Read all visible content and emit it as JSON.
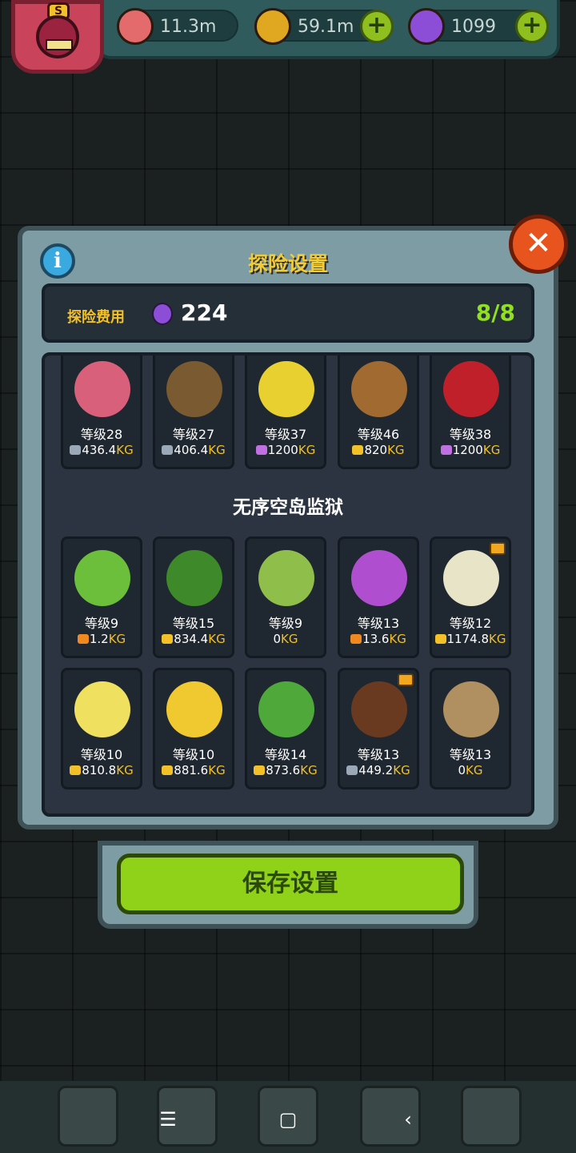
{
  "resources": {
    "eye": {
      "value": "11.3m",
      "icon": "eyeball-icon"
    },
    "coin": {
      "value": "59.1m",
      "icon": "coin-icon"
    },
    "potion": {
      "value": "1099",
      "icon": "potion-icon"
    }
  },
  "modal": {
    "title": "探险设置",
    "cost_label": "探险费用",
    "cost_value": "224",
    "slots": "8/8"
  },
  "top_row": [
    {
      "level": "等级28",
      "weight": "436.4",
      "unit": "KG",
      "bag": "silver",
      "color": "#d9607a"
    },
    {
      "level": "等级27",
      "weight": "406.4",
      "unit": "KG",
      "bag": "silver",
      "color": "#7a5a30"
    },
    {
      "level": "等级37",
      "weight": "1200",
      "unit": "KG",
      "bag": "rainbow",
      "color": "#e8d030"
    },
    {
      "level": "等级46",
      "weight": "820",
      "unit": "KG",
      "bag": "gold",
      "color": "#a06a30"
    },
    {
      "level": "等级38",
      "weight": "1200",
      "unit": "KG",
      "bag": "rainbow",
      "color": "#c0202a"
    }
  ],
  "section_title": "无序空岛监狱",
  "grid": [
    {
      "level": "等级9",
      "weight": "1.2",
      "unit": "KG",
      "bag": "orange",
      "color": "#6cbf3a",
      "crown": false
    },
    {
      "level": "等级15",
      "weight": "834.4",
      "unit": "KG",
      "bag": "gold",
      "color": "#3e8a2a",
      "crown": false
    },
    {
      "level": "等级9",
      "weight": "0",
      "unit": "KG",
      "bag": "none",
      "color": "#8fbf4a",
      "crown": false
    },
    {
      "level": "等级13",
      "weight": "13.6",
      "unit": "KG",
      "bag": "orange",
      "color": "#b04ed0",
      "crown": false
    },
    {
      "level": "等级12",
      "weight": "1174.8",
      "unit": "KG",
      "bag": "gold",
      "color": "#e8e4c8",
      "crown": true
    },
    {
      "level": "等级10",
      "weight": "810.8",
      "unit": "KG",
      "bag": "gold",
      "color": "#f0e060",
      "crown": false
    },
    {
      "level": "等级10",
      "weight": "881.6",
      "unit": "KG",
      "bag": "gold",
      "color": "#f0c830",
      "crown": false
    },
    {
      "level": "等级14",
      "weight": "873.6",
      "unit": "KG",
      "bag": "gold",
      "color": "#4ea83a",
      "crown": false
    },
    {
      "level": "等级13",
      "weight": "449.2",
      "unit": "KG",
      "bag": "silver",
      "color": "#6a3a20",
      "crown": true
    },
    {
      "level": "等级13",
      "weight": "0",
      "unit": "KG",
      "bag": "none",
      "color": "#b09060",
      "crown": false
    }
  ],
  "save_label": "保存设置",
  "colors": {
    "gold": "#f2c028",
    "green": "#90e020",
    "silver": "#9aa8b8",
    "rainbow": "#c070e0",
    "orange": "#f08a20"
  }
}
